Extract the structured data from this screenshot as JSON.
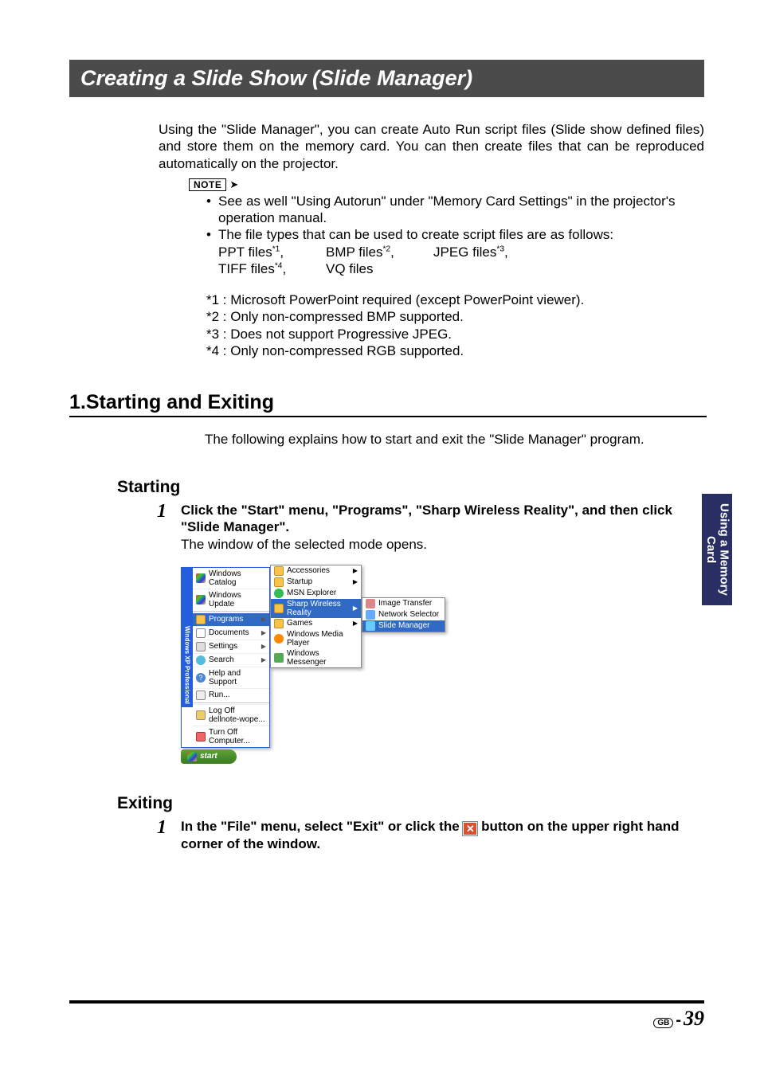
{
  "title": "Creating a Slide Show (Slide Manager)",
  "intro": "Using the \"Slide Manager\", you can create Auto Run script files (Slide show defined files) and store them on the memory card. You can then create files that can be reproduced automatically on the projector.",
  "note_label": "NOTE",
  "bullet1": "See as well \"Using Autorun\" under \"Memory Card Settings\" in the projector's operation manual.",
  "bullet2": "The file types that can be used to create script files are as follows:",
  "filetypes": {
    "r1c1": "PPT files*1,",
    "r1c2": "BMP files*2,",
    "r1c3": "JPEG files*3,",
    "r2c1": "TIFF files*4,",
    "r2c2": "VQ files"
  },
  "footnotes": {
    "f1": "*1 : Microsoft PowerPoint required (except PowerPoint viewer).",
    "f2": "*2 : Only non-compressed BMP supported.",
    "f3": "*3 : Does not support Progressive JPEG.",
    "f4": "*4 : Only non-compressed RGB supported."
  },
  "section1_heading": "1.Starting and Exiting",
  "section1_intro": "The following explains how to start and exit the \"Slide Manager\" program.",
  "starting_heading": "Starting",
  "starting_step_num": "1",
  "starting_step_bold": "Click the \"Start\" menu, \"Programs\", \"Sharp Wireless Reality\", and then click \"Slide Manager\".",
  "starting_step_text": "The window of the selected mode opens.",
  "exiting_heading": "Exiting",
  "exiting_step_num": "1",
  "exiting_step_bold_a": "In the \"File\" menu, select \"Exit\" or click the ",
  "exiting_step_bold_b": " button on the upper right hand corner of the window.",
  "close_x": "✕",
  "side_tab": "Using a Memory Card",
  "page_region": "GB",
  "page_dash": "-",
  "page_number": "39",
  "startmenu": {
    "xp_label": "Windows XP Professional",
    "items": [
      "Windows Catalog",
      "Windows Update",
      "Programs",
      "Documents",
      "Settings",
      "Search",
      "Help and Support",
      "Run...",
      "Log Off dellnote-wope...",
      "Turn Off Computer..."
    ],
    "start_btn": "start"
  },
  "submenu1": [
    "Accessories",
    "Startup",
    "MSN Explorer",
    "Sharp Wireless Reality",
    "Games",
    "Windows Media Player",
    "Windows Messenger"
  ],
  "submenu2": [
    "Image Transfer",
    "Network Selector",
    "Slide Manager"
  ]
}
